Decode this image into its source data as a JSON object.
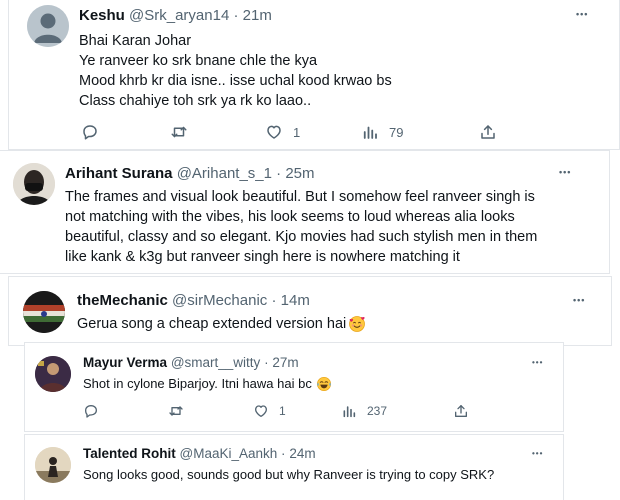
{
  "tweets": [
    {
      "name": "Keshu",
      "handle": "@Srk_aryan14",
      "time": "21m",
      "lines": [
        "Bhai Karan Johar",
        "Ye ranveer ko srk bnane chle the kya",
        "Mood khrb kr dia isne.. isse uchal kood krwao bs",
        "Class chahiye toh srk ya rk ko laao.."
      ],
      "likes": "1",
      "views": "79"
    },
    {
      "name": "Arihant Surana",
      "handle": "@Arihant_s_1",
      "time": "25m",
      "lines": [
        "The frames and visual look beautiful. But I somehow feel ranveer singh is",
        "not matching with the vibes, his look seems to loud whereas alia looks",
        "beautiful, classy and so elegant. Kjo movies had such stylish men in them",
        "like kank & k3g but ranveer singh here is nowhere matching it"
      ]
    },
    {
      "name": "theMechanic",
      "handle": "@sirMechanic",
      "time": "14m",
      "lines": [
        "Gerua song a cheap extended version hai"
      ],
      "emoji": "smiling-with-hearts"
    },
    {
      "name": "Mayur Verma",
      "handle": "@smart__witty",
      "time": "27m",
      "lines": [
        "Shot in cylone Biparjoy. Itni hawa hai bc"
      ],
      "emoji": "laughing-tears",
      "likes": "1",
      "views": "237"
    },
    {
      "name": "Talented Rohit",
      "handle": "@MaaKi_Aankh",
      "time": "24m",
      "lines": [
        "Song looks good, sounds good but why Ranveer is trying to copy SRK?"
      ]
    }
  ],
  "separator": "·",
  "more_label": "•••",
  "icons": {
    "reply": "reply-icon",
    "retweet": "retweet-icon",
    "like": "heart-icon",
    "views": "views-icon",
    "share": "share-icon",
    "more": "more-icon"
  },
  "colors": {
    "text": "#0f1419",
    "muted": "#536471",
    "border": "#e3e6ea"
  }
}
